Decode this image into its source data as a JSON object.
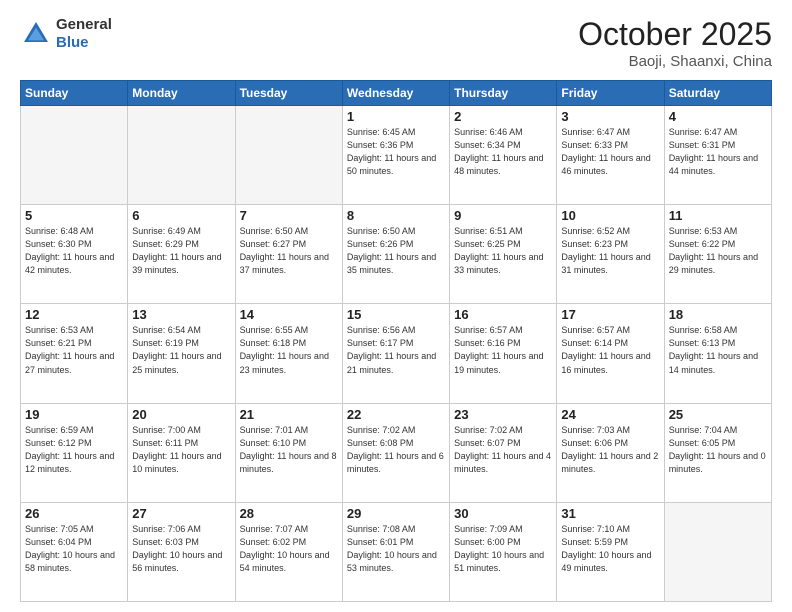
{
  "header": {
    "logo_general": "General",
    "logo_blue": "Blue",
    "month": "October 2025",
    "location": "Baoji, Shaanxi, China"
  },
  "days_of_week": [
    "Sunday",
    "Monday",
    "Tuesday",
    "Wednesday",
    "Thursday",
    "Friday",
    "Saturday"
  ],
  "weeks": [
    [
      {
        "day": "",
        "info": ""
      },
      {
        "day": "",
        "info": ""
      },
      {
        "day": "",
        "info": ""
      },
      {
        "day": "1",
        "info": "Sunrise: 6:45 AM\nSunset: 6:36 PM\nDaylight: 11 hours\nand 50 minutes."
      },
      {
        "day": "2",
        "info": "Sunrise: 6:46 AM\nSunset: 6:34 PM\nDaylight: 11 hours\nand 48 minutes."
      },
      {
        "day": "3",
        "info": "Sunrise: 6:47 AM\nSunset: 6:33 PM\nDaylight: 11 hours\nand 46 minutes."
      },
      {
        "day": "4",
        "info": "Sunrise: 6:47 AM\nSunset: 6:31 PM\nDaylight: 11 hours\nand 44 minutes."
      }
    ],
    [
      {
        "day": "5",
        "info": "Sunrise: 6:48 AM\nSunset: 6:30 PM\nDaylight: 11 hours\nand 42 minutes."
      },
      {
        "day": "6",
        "info": "Sunrise: 6:49 AM\nSunset: 6:29 PM\nDaylight: 11 hours\nand 39 minutes."
      },
      {
        "day": "7",
        "info": "Sunrise: 6:50 AM\nSunset: 6:27 PM\nDaylight: 11 hours\nand 37 minutes."
      },
      {
        "day": "8",
        "info": "Sunrise: 6:50 AM\nSunset: 6:26 PM\nDaylight: 11 hours\nand 35 minutes."
      },
      {
        "day": "9",
        "info": "Sunrise: 6:51 AM\nSunset: 6:25 PM\nDaylight: 11 hours\nand 33 minutes."
      },
      {
        "day": "10",
        "info": "Sunrise: 6:52 AM\nSunset: 6:23 PM\nDaylight: 11 hours\nand 31 minutes."
      },
      {
        "day": "11",
        "info": "Sunrise: 6:53 AM\nSunset: 6:22 PM\nDaylight: 11 hours\nand 29 minutes."
      }
    ],
    [
      {
        "day": "12",
        "info": "Sunrise: 6:53 AM\nSunset: 6:21 PM\nDaylight: 11 hours\nand 27 minutes."
      },
      {
        "day": "13",
        "info": "Sunrise: 6:54 AM\nSunset: 6:19 PM\nDaylight: 11 hours\nand 25 minutes."
      },
      {
        "day": "14",
        "info": "Sunrise: 6:55 AM\nSunset: 6:18 PM\nDaylight: 11 hours\nand 23 minutes."
      },
      {
        "day": "15",
        "info": "Sunrise: 6:56 AM\nSunset: 6:17 PM\nDaylight: 11 hours\nand 21 minutes."
      },
      {
        "day": "16",
        "info": "Sunrise: 6:57 AM\nSunset: 6:16 PM\nDaylight: 11 hours\nand 19 minutes."
      },
      {
        "day": "17",
        "info": "Sunrise: 6:57 AM\nSunset: 6:14 PM\nDaylight: 11 hours\nand 16 minutes."
      },
      {
        "day": "18",
        "info": "Sunrise: 6:58 AM\nSunset: 6:13 PM\nDaylight: 11 hours\nand 14 minutes."
      }
    ],
    [
      {
        "day": "19",
        "info": "Sunrise: 6:59 AM\nSunset: 6:12 PM\nDaylight: 11 hours\nand 12 minutes."
      },
      {
        "day": "20",
        "info": "Sunrise: 7:00 AM\nSunset: 6:11 PM\nDaylight: 11 hours\nand 10 minutes."
      },
      {
        "day": "21",
        "info": "Sunrise: 7:01 AM\nSunset: 6:10 PM\nDaylight: 11 hours\nand 8 minutes."
      },
      {
        "day": "22",
        "info": "Sunrise: 7:02 AM\nSunset: 6:08 PM\nDaylight: 11 hours\nand 6 minutes."
      },
      {
        "day": "23",
        "info": "Sunrise: 7:02 AM\nSunset: 6:07 PM\nDaylight: 11 hours\nand 4 minutes."
      },
      {
        "day": "24",
        "info": "Sunrise: 7:03 AM\nSunset: 6:06 PM\nDaylight: 11 hours\nand 2 minutes."
      },
      {
        "day": "25",
        "info": "Sunrise: 7:04 AM\nSunset: 6:05 PM\nDaylight: 11 hours\nand 0 minutes."
      }
    ],
    [
      {
        "day": "26",
        "info": "Sunrise: 7:05 AM\nSunset: 6:04 PM\nDaylight: 10 hours\nand 58 minutes."
      },
      {
        "day": "27",
        "info": "Sunrise: 7:06 AM\nSunset: 6:03 PM\nDaylight: 10 hours\nand 56 minutes."
      },
      {
        "day": "28",
        "info": "Sunrise: 7:07 AM\nSunset: 6:02 PM\nDaylight: 10 hours\nand 54 minutes."
      },
      {
        "day": "29",
        "info": "Sunrise: 7:08 AM\nSunset: 6:01 PM\nDaylight: 10 hours\nand 53 minutes."
      },
      {
        "day": "30",
        "info": "Sunrise: 7:09 AM\nSunset: 6:00 PM\nDaylight: 10 hours\nand 51 minutes."
      },
      {
        "day": "31",
        "info": "Sunrise: 7:10 AM\nSunset: 5:59 PM\nDaylight: 10 hours\nand 49 minutes."
      },
      {
        "day": "",
        "info": ""
      }
    ]
  ]
}
